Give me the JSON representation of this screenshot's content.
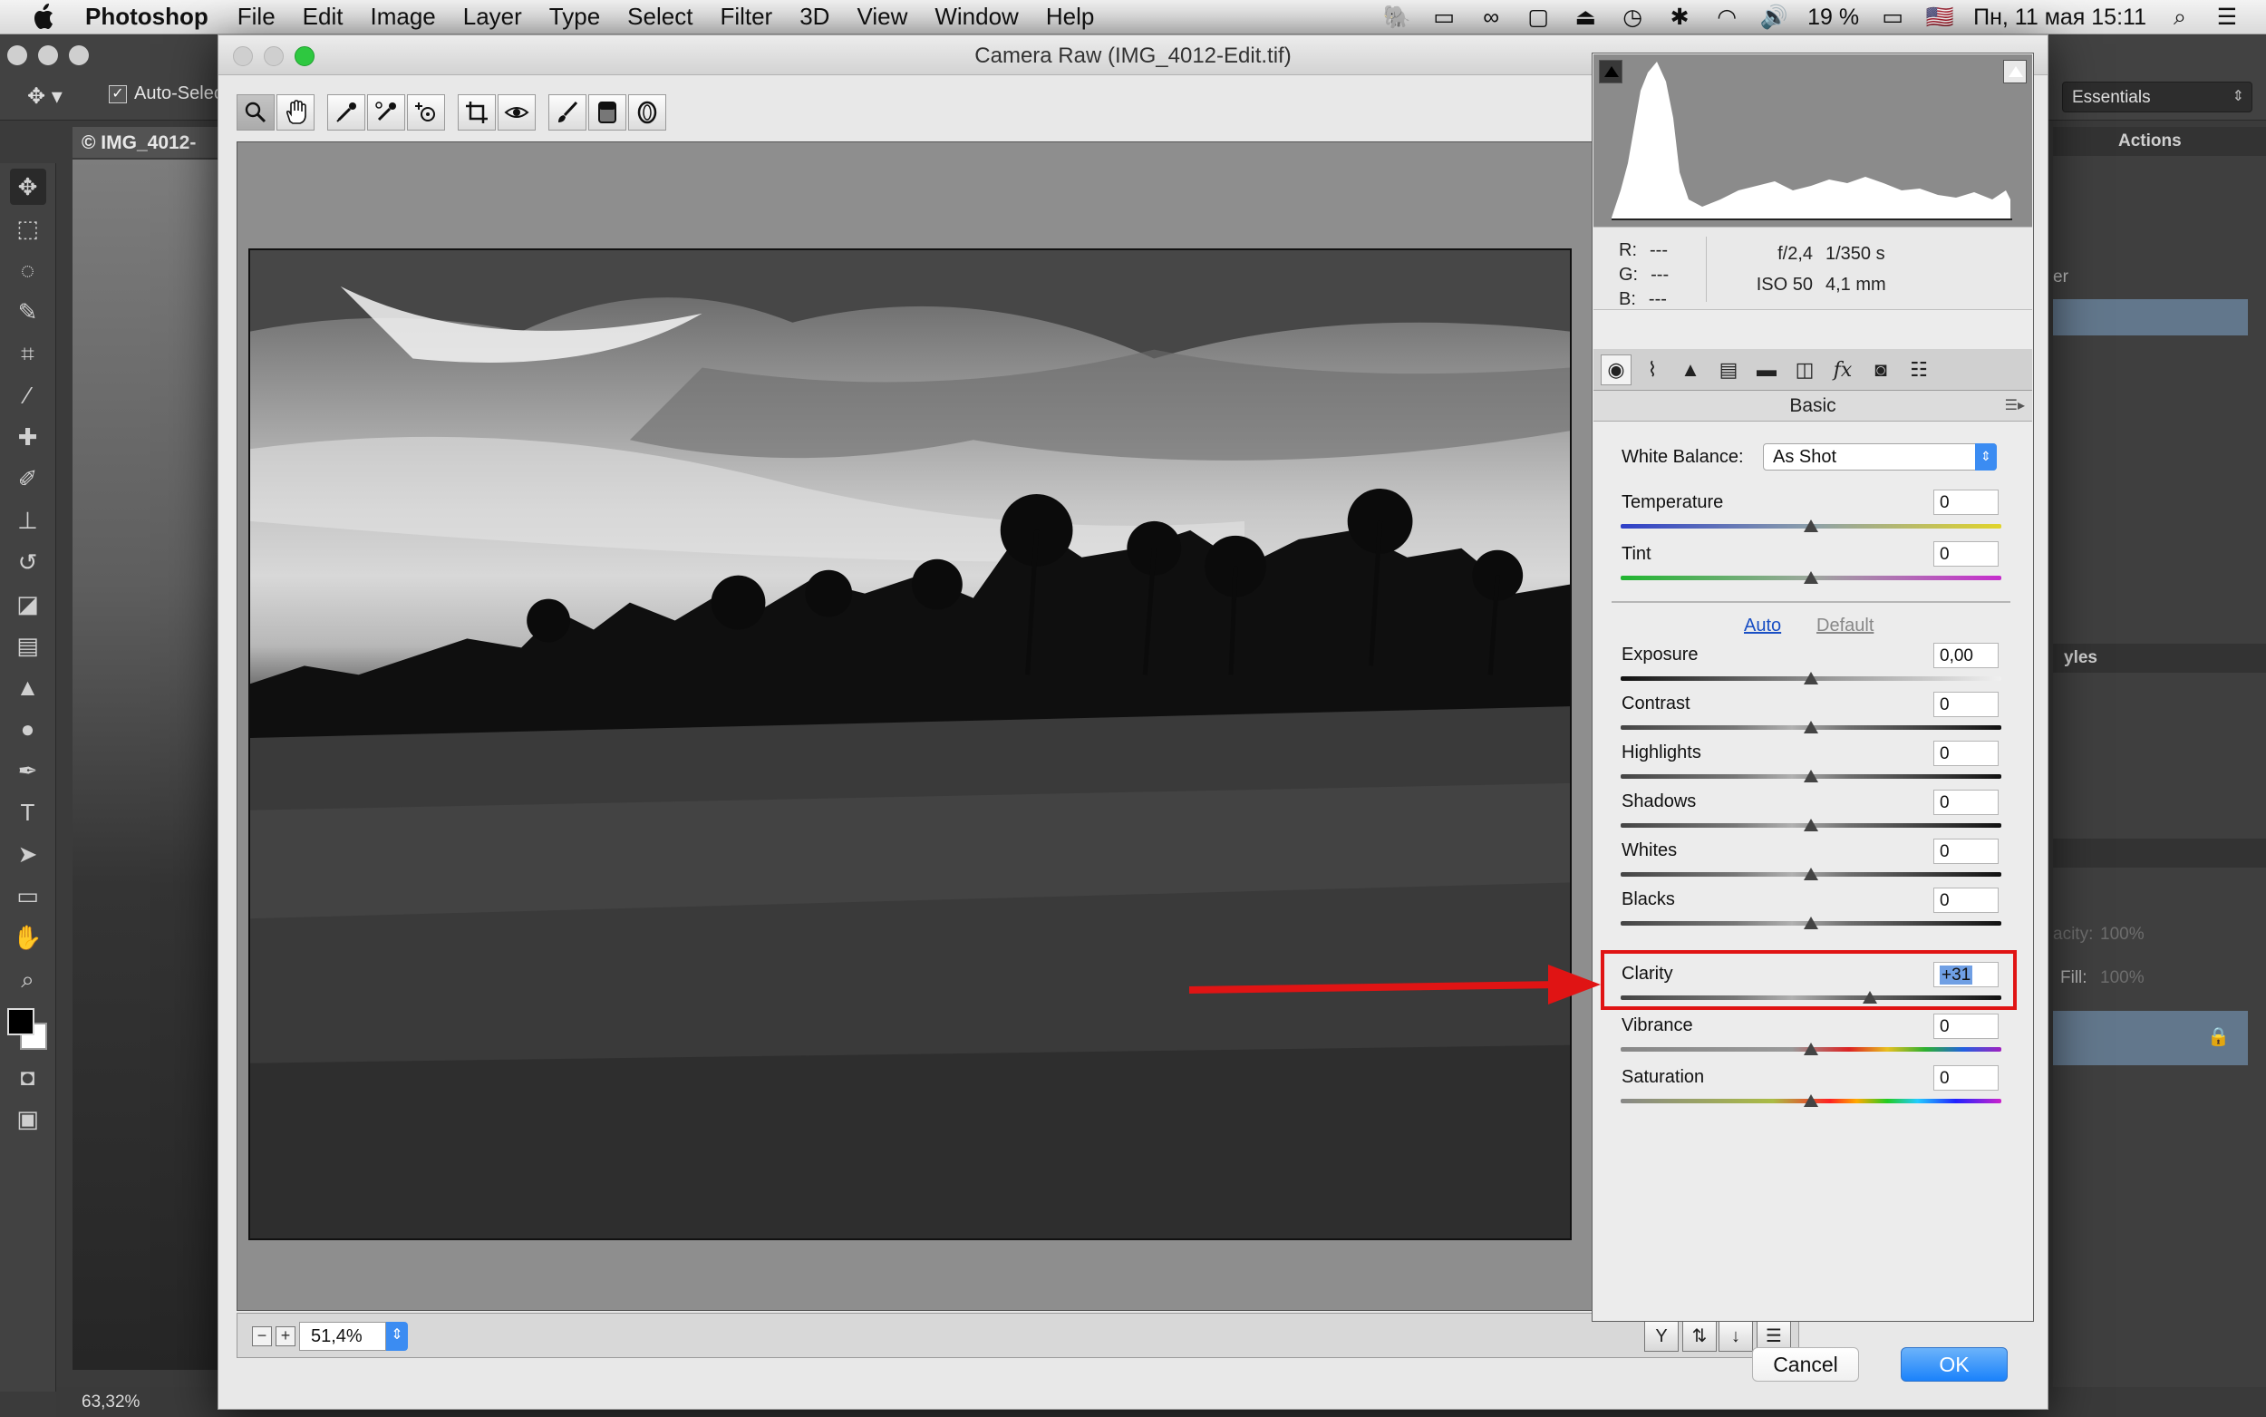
{
  "menubar": {
    "app_name": "Photoshop",
    "items": [
      "File",
      "Edit",
      "Image",
      "Layer",
      "Type",
      "Select",
      "Filter",
      "3D",
      "View",
      "Window",
      "Help"
    ],
    "battery": "19 %",
    "datetime": "Пн, 11 мая  15:11"
  },
  "photoshop": {
    "auto_select_label": "Auto-Selec",
    "workspace": "Essentials",
    "doc_tab": "© IMG_4012-",
    "zoom_status": "63,32%",
    "panels": {
      "actions_tab": "Actions",
      "styles_tab": "yles",
      "layer_fragment": "er",
      "opacity_label": "acity:",
      "opacity_value": "100%",
      "fill_label": "Fill:",
      "fill_value": "100%"
    }
  },
  "camera_raw": {
    "title": "Camera Raw (IMG_4012-Edit.tif)",
    "zoom": "51,4%",
    "readout": {
      "r_label": "R:",
      "r_value": "---",
      "g_label": "G:",
      "g_value": "---",
      "b_label": "B:",
      "b_value": "---",
      "aperture": "f/2,4",
      "shutter": "1/350 s",
      "iso": "ISO 50",
      "focal": "4,1 mm"
    },
    "panel_name": "Basic",
    "white_balance_label": "White Balance:",
    "white_balance_value": "As Shot",
    "auto_label": "Auto",
    "default_label": "Default",
    "sliders": [
      {
        "label": "Temperature",
        "value": "0",
        "position": 0.5
      },
      {
        "label": "Tint",
        "value": "0",
        "position": 0.5
      },
      {
        "label": "Exposure",
        "value": "0,00",
        "position": 0.5
      },
      {
        "label": "Contrast",
        "value": "0",
        "position": 0.5
      },
      {
        "label": "Highlights",
        "value": "0",
        "position": 0.5
      },
      {
        "label": "Shadows",
        "value": "0",
        "position": 0.5
      },
      {
        "label": "Whites",
        "value": "0",
        "position": 0.5
      },
      {
        "label": "Blacks",
        "value": "0",
        "position": 0.5
      },
      {
        "label": "Clarity",
        "value": "+31",
        "position": 0.655
      },
      {
        "label": "Vibrance",
        "value": "0",
        "position": 0.5
      },
      {
        "label": "Saturation",
        "value": "0",
        "position": 0.5
      }
    ],
    "cancel_label": "Cancel",
    "ok_label": "OK"
  },
  "colors": {
    "highlight_box": "#e01414",
    "arrow": "#e01414",
    "ok_button": "#1a82fb"
  }
}
